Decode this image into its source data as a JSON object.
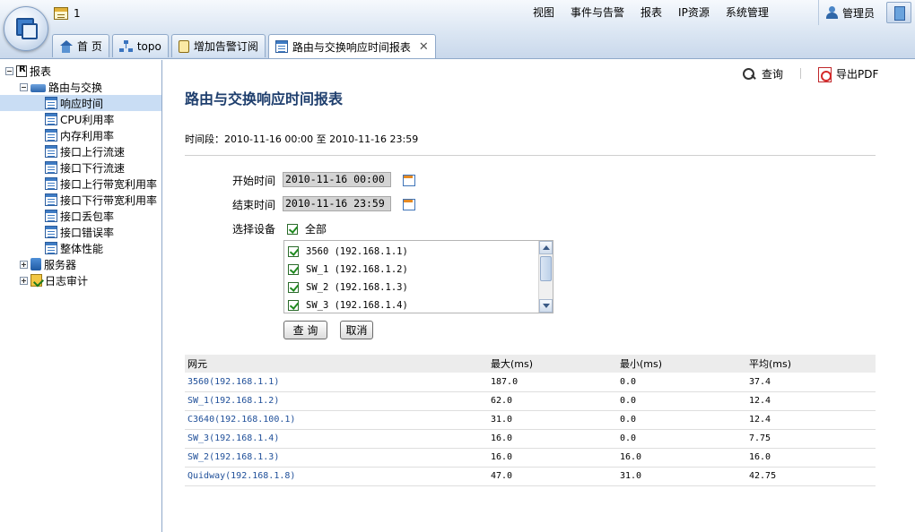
{
  "header": {
    "message_count": "1",
    "nav": [
      "视图",
      "事件与告警",
      "报表",
      "IP资源",
      "系统管理"
    ],
    "user": "管理员"
  },
  "tabs": [
    {
      "label": "首 页",
      "icon": "home-icon"
    },
    {
      "label": "topo",
      "icon": "topology-icon"
    },
    {
      "label": "增加告警订阅",
      "icon": "alarm-subscribe-icon"
    },
    {
      "label": "路由与交换响应时间报表",
      "icon": "report-icon",
      "active": true,
      "close": "✕"
    }
  ],
  "sidebar": {
    "root": "报表",
    "group": "路由与交换",
    "items": [
      "响应时间",
      "CPU利用率",
      "内存利用率",
      "接口上行流速",
      "接口下行流速",
      "接口上行带宽利用率",
      "接口下行带宽利用率",
      "接口丢包率",
      "接口错误率",
      "整体性能"
    ],
    "selected": "响应时间",
    "servers": "服务器",
    "audit": "日志审计"
  },
  "toolbar": {
    "query": "查询",
    "export_pdf": "导出PDF"
  },
  "report": {
    "title": "路由与交换响应时间报表",
    "period": "时间段：2010-11-16 00:00 至 2010-11-16 23:59"
  },
  "form": {
    "start_label": "开始时间",
    "start_value": "2010-11-16 00:00",
    "end_label": "结束时间",
    "end_value": "2010-11-16 23:59",
    "device_label": "选择设备",
    "all_label": "全部",
    "devices": [
      "3560 (192.168.1.1)",
      "SW_1 (192.168.1.2)",
      "SW_2 (192.168.1.3)",
      "SW_3 (192.168.1.4)"
    ],
    "query_button": "查 询",
    "cancel_button": "取消"
  },
  "table": {
    "columns": [
      "网元",
      "最大(ms)",
      "最小(ms)",
      "平均(ms)"
    ],
    "rows": [
      [
        "3560(192.168.1.1)",
        "187.0",
        "0.0",
        "37.4"
      ],
      [
        "SW_1(192.168.1.2)",
        "62.0",
        "0.0",
        "12.4"
      ],
      [
        "C3640(192.168.100.1)",
        "31.0",
        "0.0",
        "12.4"
      ],
      [
        "SW_3(192.168.1.4)",
        "16.0",
        "0.0",
        "7.75"
      ],
      [
        "SW_2(192.168.1.3)",
        "16.0",
        "16.0",
        "16.0"
      ],
      [
        "Quidway(192.168.1.8)",
        "47.0",
        "31.0",
        "42.75"
      ]
    ]
  }
}
